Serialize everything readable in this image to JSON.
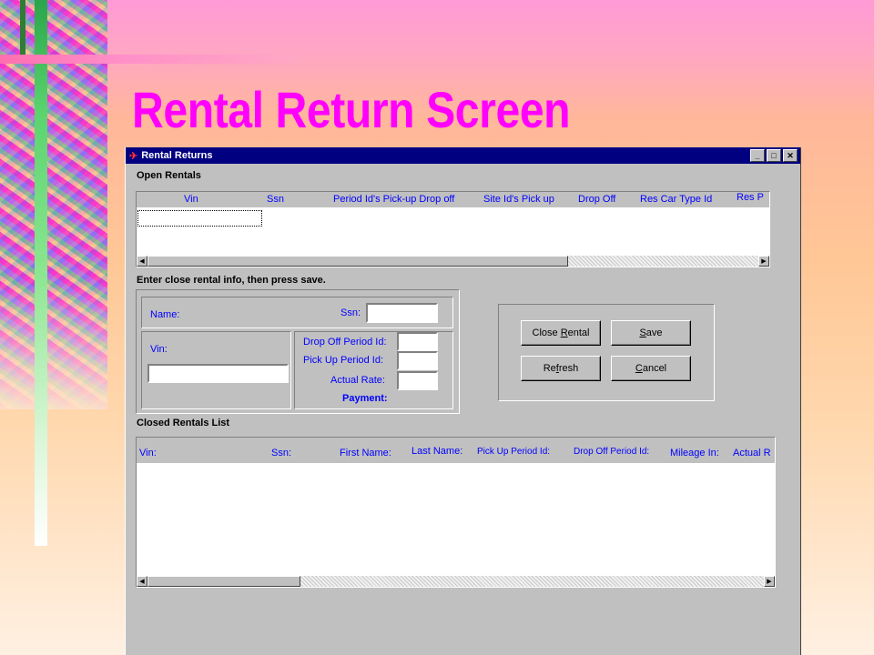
{
  "slide": {
    "title": "Rental Return Screen"
  },
  "window": {
    "title": "Rental Returns",
    "controls": {
      "minimize": "_",
      "maximize": "□",
      "close": "✕"
    }
  },
  "open_rentals": {
    "label": "Open Rentals",
    "columns": [
      "Vin",
      "Ssn",
      "Period Id's Pick-up Drop off",
      "Site Id's Pick up",
      "Drop Off",
      "Res Car Type Id",
      "Res P"
    ]
  },
  "instructions": "Enter close rental info, then press save.",
  "form": {
    "name_label": "Name:",
    "ssn_label": "Ssn:",
    "vin_label": "Vin:",
    "drop_off_period_label": "Drop Off Period Id:",
    "pick_up_period_label": "Pick Up Period Id:",
    "actual_rate_label": "Actual Rate:",
    "payment_label": "Payment:"
  },
  "buttons": {
    "close_rental": {
      "pre": "Close ",
      "key": "R",
      "post": "ental"
    },
    "save": {
      "pre": "",
      "key": "S",
      "post": "ave"
    },
    "refresh": {
      "pre": "Re",
      "key": "f",
      "post": "resh"
    },
    "cancel": {
      "pre": "",
      "key": "C",
      "post": "ancel"
    }
  },
  "closed_rentals": {
    "label": "Closed Rentals List",
    "columns": [
      "Vin:",
      "Ssn:",
      "First Name:",
      "Last Name:",
      "Pick Up Period Id:",
      "Drop Off Period Id:",
      "Mileage In:",
      "Actual R"
    ]
  },
  "icons": {
    "app": "car-app-icon",
    "scroll_left": "◀",
    "scroll_right": "▶"
  },
  "colors": {
    "title": "#ff00ff",
    "titlebar": "#000080",
    "header_text": "#0000ff",
    "window_bg": "#c0c0c0"
  }
}
